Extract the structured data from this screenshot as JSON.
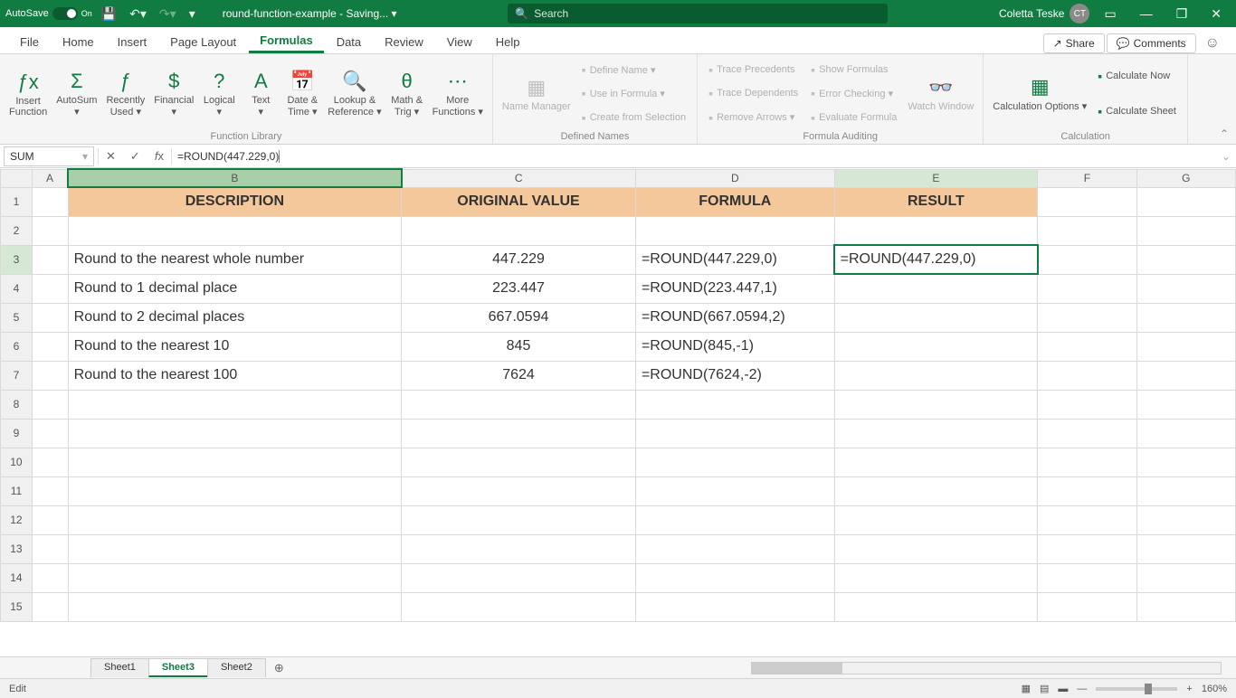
{
  "titlebar": {
    "autosave": "AutoSave",
    "autosave_state": "On",
    "doc": "round-function-example - Saving... ▾",
    "search_placeholder": "Search",
    "user": "Coletta Teske",
    "initials": "CT"
  },
  "tabs": {
    "items": [
      "File",
      "Home",
      "Insert",
      "Page Layout",
      "Formulas",
      "Data",
      "Review",
      "View",
      "Help"
    ],
    "active": "Formulas",
    "share": "Share",
    "comments": "Comments"
  },
  "ribbon": {
    "g1": {
      "label": "Function Library",
      "items": [
        "Insert\nFunction",
        "AutoSum\n▾",
        "Recently\nUsed ▾",
        "Financial\n▾",
        "Logical\n▾",
        "Text\n▾",
        "Date &\nTime ▾",
        "Lookup &\nReference ▾",
        "Math &\nTrig ▾",
        "More\nFunctions ▾"
      ]
    },
    "g2": {
      "label": "Defined Names",
      "big": "Name\nManager",
      "small": [
        "Define Name ▾",
        "Use in Formula ▾",
        "Create from Selection"
      ]
    },
    "g3": {
      "label": "Formula Auditing",
      "col1": [
        "Trace Precedents",
        "Trace Dependents",
        "Remove Arrows ▾"
      ],
      "col2": [
        "Show Formulas",
        "Error Checking ▾",
        "Evaluate Formula"
      ],
      "watch": "Watch\nWindow"
    },
    "g4": {
      "label": "Calculation",
      "big": "Calculation\nOptions ▾",
      "small": [
        "Calculate Now",
        "Calculate Sheet"
      ]
    }
  },
  "formula_bar": {
    "name": "SUM",
    "formula": "=ROUND(447.229,0)"
  },
  "columns": [
    "",
    "A",
    "B",
    "C",
    "D",
    "E",
    "F",
    "G"
  ],
  "headers": {
    "B": "DESCRIPTION",
    "C": "ORIGINAL VALUE",
    "D": "FORMULA",
    "E": "RESULT"
  },
  "rows": [
    {
      "n": 1,
      "hdr": true
    },
    {
      "n": 2
    },
    {
      "n": 3,
      "B": "Round to the nearest whole number",
      "C": "447.229",
      "D": "=ROUND(447.229,0)",
      "E": "=ROUND(447.229,0)",
      "edit": true
    },
    {
      "n": 4,
      "B": "Round to 1 decimal place",
      "C": "223.447",
      "D": "=ROUND(223.447,1)"
    },
    {
      "n": 5,
      "B": "Round to 2 decimal places",
      "C": "667.0594",
      "D": "=ROUND(667.0594,2)"
    },
    {
      "n": 6,
      "B": "Round to the nearest 10",
      "C": "845",
      "D": "=ROUND(845,-1)"
    },
    {
      "n": 7,
      "B": "Round to the nearest 100",
      "C": "7624",
      "D": "=ROUND(7624,-2)"
    },
    {
      "n": 8
    },
    {
      "n": 9
    },
    {
      "n": 10
    },
    {
      "n": 11
    },
    {
      "n": 12
    },
    {
      "n": 13
    },
    {
      "n": 14
    },
    {
      "n": 15
    }
  ],
  "sheets": {
    "items": [
      "Sheet1",
      "Sheet3",
      "Sheet2"
    ],
    "active": "Sheet3"
  },
  "statusbar": {
    "mode": "Edit",
    "zoom": "160%"
  }
}
